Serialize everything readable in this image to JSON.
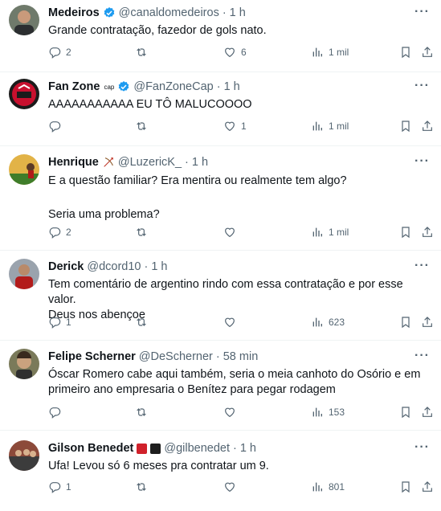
{
  "tweets": [
    {
      "name": "Medeiros",
      "handle": "@canaldomedeiros",
      "dot": "·",
      "time": "1 h",
      "text": [
        "Grande contratação, fazedor de gols nato."
      ],
      "replies": "2",
      "retweets": "",
      "likes": "6",
      "views": "1 mil",
      "verified": true
    },
    {
      "name": "Fan Zone",
      "name_sup": "cap",
      "handle": "@FanZoneCap",
      "dot": "·",
      "time": "1 h",
      "text": [
        "AAAAAAAAAAA EU TÔ MALUCOOOO"
      ],
      "replies": "",
      "retweets": "",
      "likes": "1",
      "views": "1 mil",
      "verified": true
    },
    {
      "name": "Henrique",
      "handle": "@LuzericK_",
      "dot": "·",
      "time": "1 h",
      "text": [
        "E a questão familiar? Era mentira ou realmente tem algo?",
        "",
        "Seria uma problema?"
      ],
      "replies": "2",
      "retweets": "",
      "likes": "",
      "views": "1 mil",
      "verified": false
    },
    {
      "name": "Derick",
      "handle": "@dcord10",
      "dot": "·",
      "time": "1 h",
      "text": [
        "Tem comentário de argentino rindo com essa contratação e por esse valor.",
        "Deus nos abençoe"
      ],
      "replies": "1",
      "retweets": "",
      "likes": "",
      "views": "623",
      "verified": false
    },
    {
      "name": "Felipe Scherner",
      "handle": "@DeScherner",
      "dot": "·",
      "time": "58 min",
      "text": [
        "Óscar Romero cabe aqui também, seria o meia canhoto do Osório e em",
        "primeiro ano empresaria o Benítez para pegar rodagem"
      ],
      "replies": "",
      "retweets": "",
      "likes": "",
      "views": "153",
      "verified": false
    },
    {
      "name": "Gilson Benedet",
      "handle": "@gilbenedet",
      "dot": "·",
      "time": "1 h",
      "text": [
        "Ufa! Levou só 6 meses pra contratar um 9."
      ],
      "replies": "1",
      "retweets": "",
      "likes": "",
      "views": "801",
      "verified": false
    }
  ],
  "colors": {
    "verified_blue": "#1d9bf0",
    "muted": "#536471",
    "text": "#0f1419",
    "badge_red": "#d0212b",
    "badge_black": "#1e1e1e"
  },
  "icons": {
    "reply": "reply-icon",
    "retweet": "retweet-icon",
    "like": "like-icon",
    "views": "views-icon",
    "bookmark": "bookmark-icon",
    "share": "share-icon",
    "more": "more-icon",
    "verified": "verified-icon"
  },
  "more_glyph": "···"
}
